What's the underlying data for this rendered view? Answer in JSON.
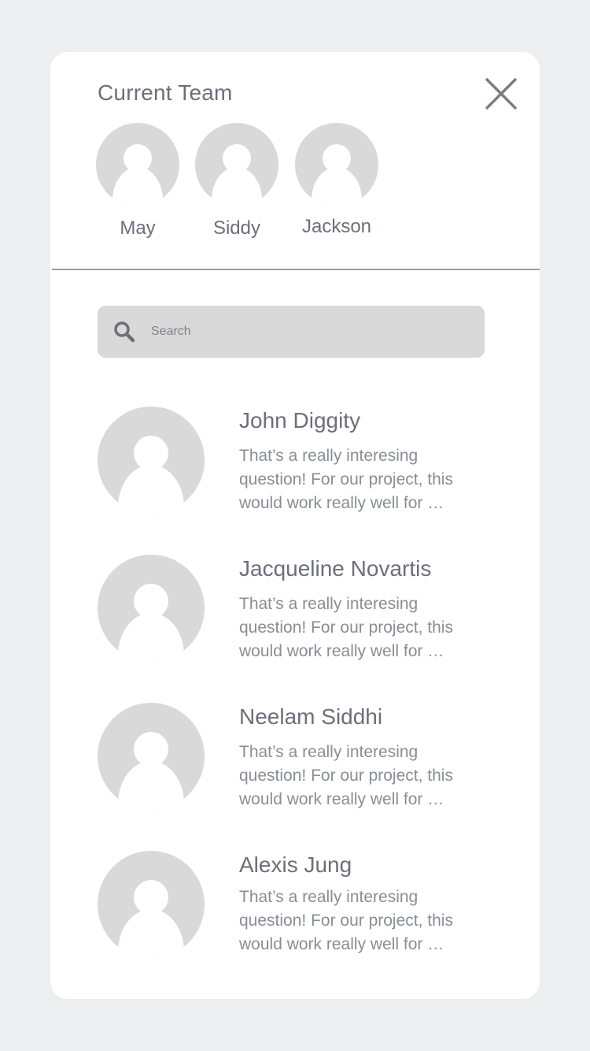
{
  "header": {
    "title": "Current Team",
    "close_icon": "close-icon"
  },
  "team": [
    {
      "name": "May",
      "icon": "user-avatar-icon"
    },
    {
      "name": "Siddy",
      "icon": "user-avatar-icon"
    },
    {
      "name": "Jackson",
      "icon": "user-avatar-icon"
    }
  ],
  "search": {
    "placeholder": "Search",
    "icon": "search-icon"
  },
  "chats": [
    {
      "name": "John Diggity",
      "preview": "That’s a really interesing question! For our project, this would work really well for …"
    },
    {
      "name": "Jacqueline Novartis",
      "preview": "That’s a really interesing question! For our project, this would work really well for …"
    },
    {
      "name": "Neelam Siddhi",
      "preview": "That’s a really interesing question! For our project, this would work really well for …"
    },
    {
      "name": "Alexis Jung",
      "preview": "That’s a really interesing question! For our project, this would work really well for …"
    }
  ],
  "colors": {
    "background": "#eceef0",
    "card": "#ffffff",
    "text": "#6b6f7b",
    "placeholder_gray": "#d9d9d9"
  }
}
